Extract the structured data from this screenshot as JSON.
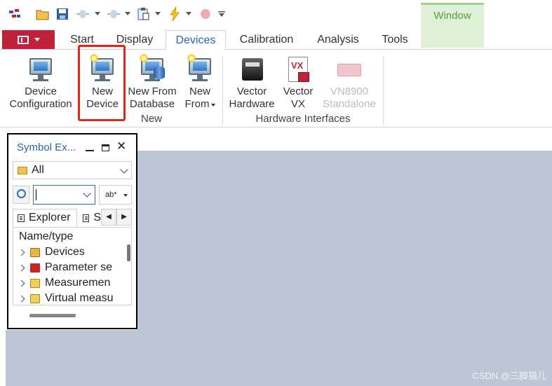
{
  "qat": {
    "icons": [
      "app-logo-icon",
      "open-folder-icon",
      "save-icon",
      "connect-icon",
      "disconnect-icon",
      "clipboard-icon",
      "flash-icon",
      "record-icon",
      "customize-icon"
    ]
  },
  "window_tab": "Window",
  "tabs": [
    "Start",
    "Display",
    "Devices",
    "Calibration",
    "Analysis",
    "Tools"
  ],
  "active_tab": "Devices",
  "ribbon": {
    "buttons": [
      {
        "line1": "Device",
        "line2": "Configuration",
        "icon": "monitor-icon"
      },
      {
        "line1": "New",
        "line2": "Device",
        "icon": "new-device-icon"
      },
      {
        "line1": "New From",
        "line2": "Database",
        "icon": "database-icon"
      },
      {
        "line1": "New",
        "line2": "From",
        "icon": "new-from-icon"
      },
      {
        "line1": "Vector",
        "line2": "Hardware",
        "icon": "hardware-icon"
      },
      {
        "line1": "Vector",
        "line2": "VX",
        "icon": "vx-icon"
      },
      {
        "line1": "VN8900",
        "line2": "Standalone",
        "icon": "vn8900-icon"
      }
    ],
    "groups": [
      "New",
      "Hardware Interfaces"
    ]
  },
  "panel": {
    "title": "Symbol Ex...",
    "filter_value": "All",
    "search_value": "",
    "ab_label": "ab*",
    "subtabs": [
      "Explorer",
      "S"
    ],
    "tree_header": "Name/type",
    "tree_items": [
      "Devices",
      "Parameter se",
      "Measuremen",
      "Virtual measu"
    ]
  },
  "watermark": "CSDN @三脚猫儿",
  "colors": {
    "app_menu": "#c0223b",
    "accent": "#2a62b0",
    "workspace": "#bcc6d4",
    "highlight": "#e8231a",
    "window_tab": "#dff0d8"
  }
}
